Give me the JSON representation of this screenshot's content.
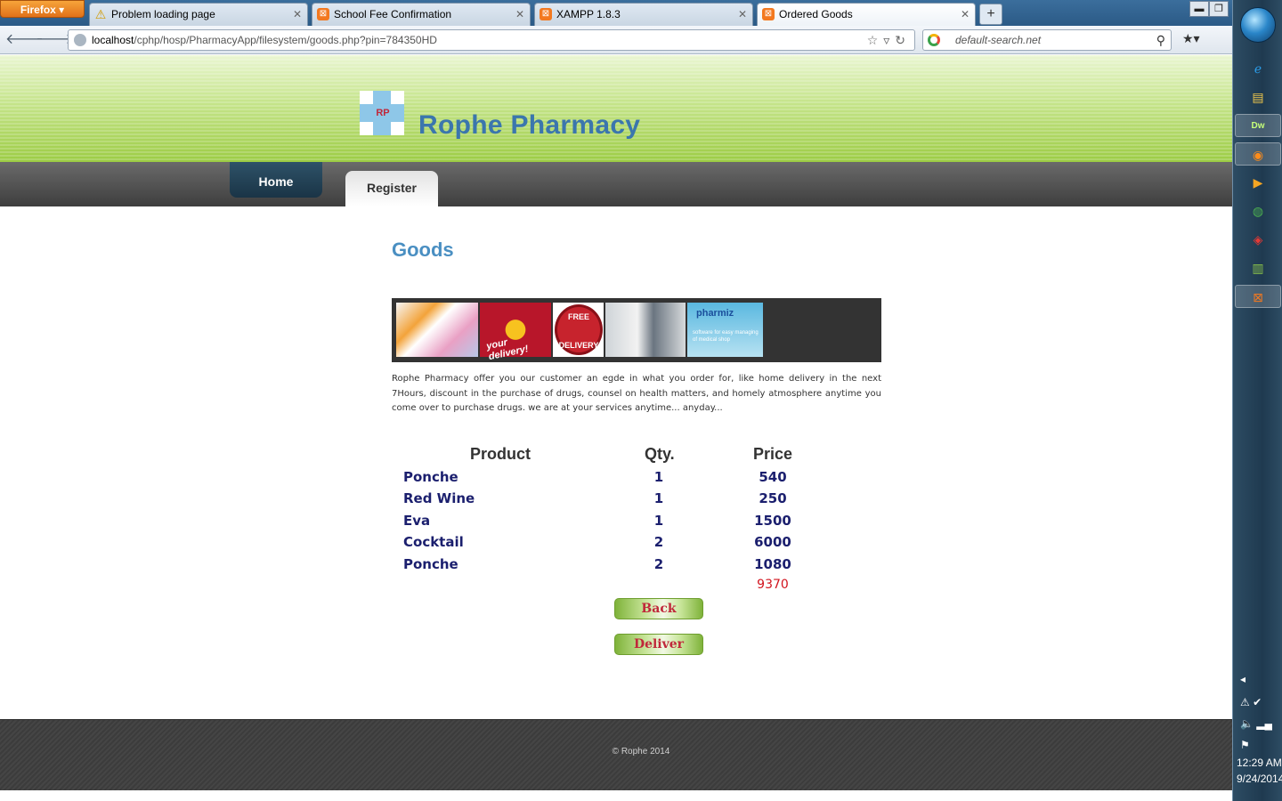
{
  "browser": {
    "menu_button": "Firefox",
    "tabs": [
      {
        "title": "Problem loading page",
        "icon": "warning-icon"
      },
      {
        "title": "School Fee Confirmation",
        "icon": "xampp-icon"
      },
      {
        "title": "XAMPP 1.8.3",
        "icon": "xampp-icon"
      },
      {
        "title": "Ordered Goods",
        "icon": "xampp-icon",
        "active": true
      }
    ],
    "url_host": "localhost",
    "url_path": "/cphp/hosp/PharmacyApp/filesystem/goods.php?pin=784350HD",
    "search_placeholder": "default-search.net"
  },
  "site": {
    "logo_text": "RP",
    "title": "Rophe Pharmacy",
    "menu": {
      "home": "Home",
      "register": "Register"
    }
  },
  "main": {
    "heading": "Goods",
    "gallery": {
      "delivery_text": "your delivery!",
      "badge_top": "FREE",
      "badge_bottom": "DELIVERY",
      "brand": "pharmiz",
      "tagline": "software for easy managing of medical shop"
    },
    "intro": "Rophe Pharmacy offer you our customer an egde in what you order for, like home delivery in the next 7Hours, discount in the purchase of drugs, counsel on health matters, and homely atmosphere anytime you come over to purchase drugs. we are at your services anytime... anyday...",
    "table": {
      "headers": {
        "product": "Product",
        "qty": "Qty.",
        "price": "Price"
      },
      "rows": [
        {
          "product": "Ponche",
          "qty": "1",
          "price": "540"
        },
        {
          "product": "Red Wine",
          "qty": "1",
          "price": "250"
        },
        {
          "product": "Eva",
          "qty": "1",
          "price": "1500"
        },
        {
          "product": "Cocktail",
          "qty": "2",
          "price": "6000"
        },
        {
          "product": "Ponche",
          "qty": "2",
          "price": "1080"
        }
      ],
      "total": "9370"
    },
    "buttons": {
      "back": "Back",
      "deliver": "Deliver"
    }
  },
  "footer": {
    "text": "© Rophe 2014"
  },
  "taskbar": {
    "time": "12:29 AM",
    "date": "9/24/2014"
  },
  "colors": {
    "accent": "#3b76ad",
    "header_green": "#9ccc44",
    "total_red": "#d2141e",
    "row_navy": "#1b1f6e"
  }
}
